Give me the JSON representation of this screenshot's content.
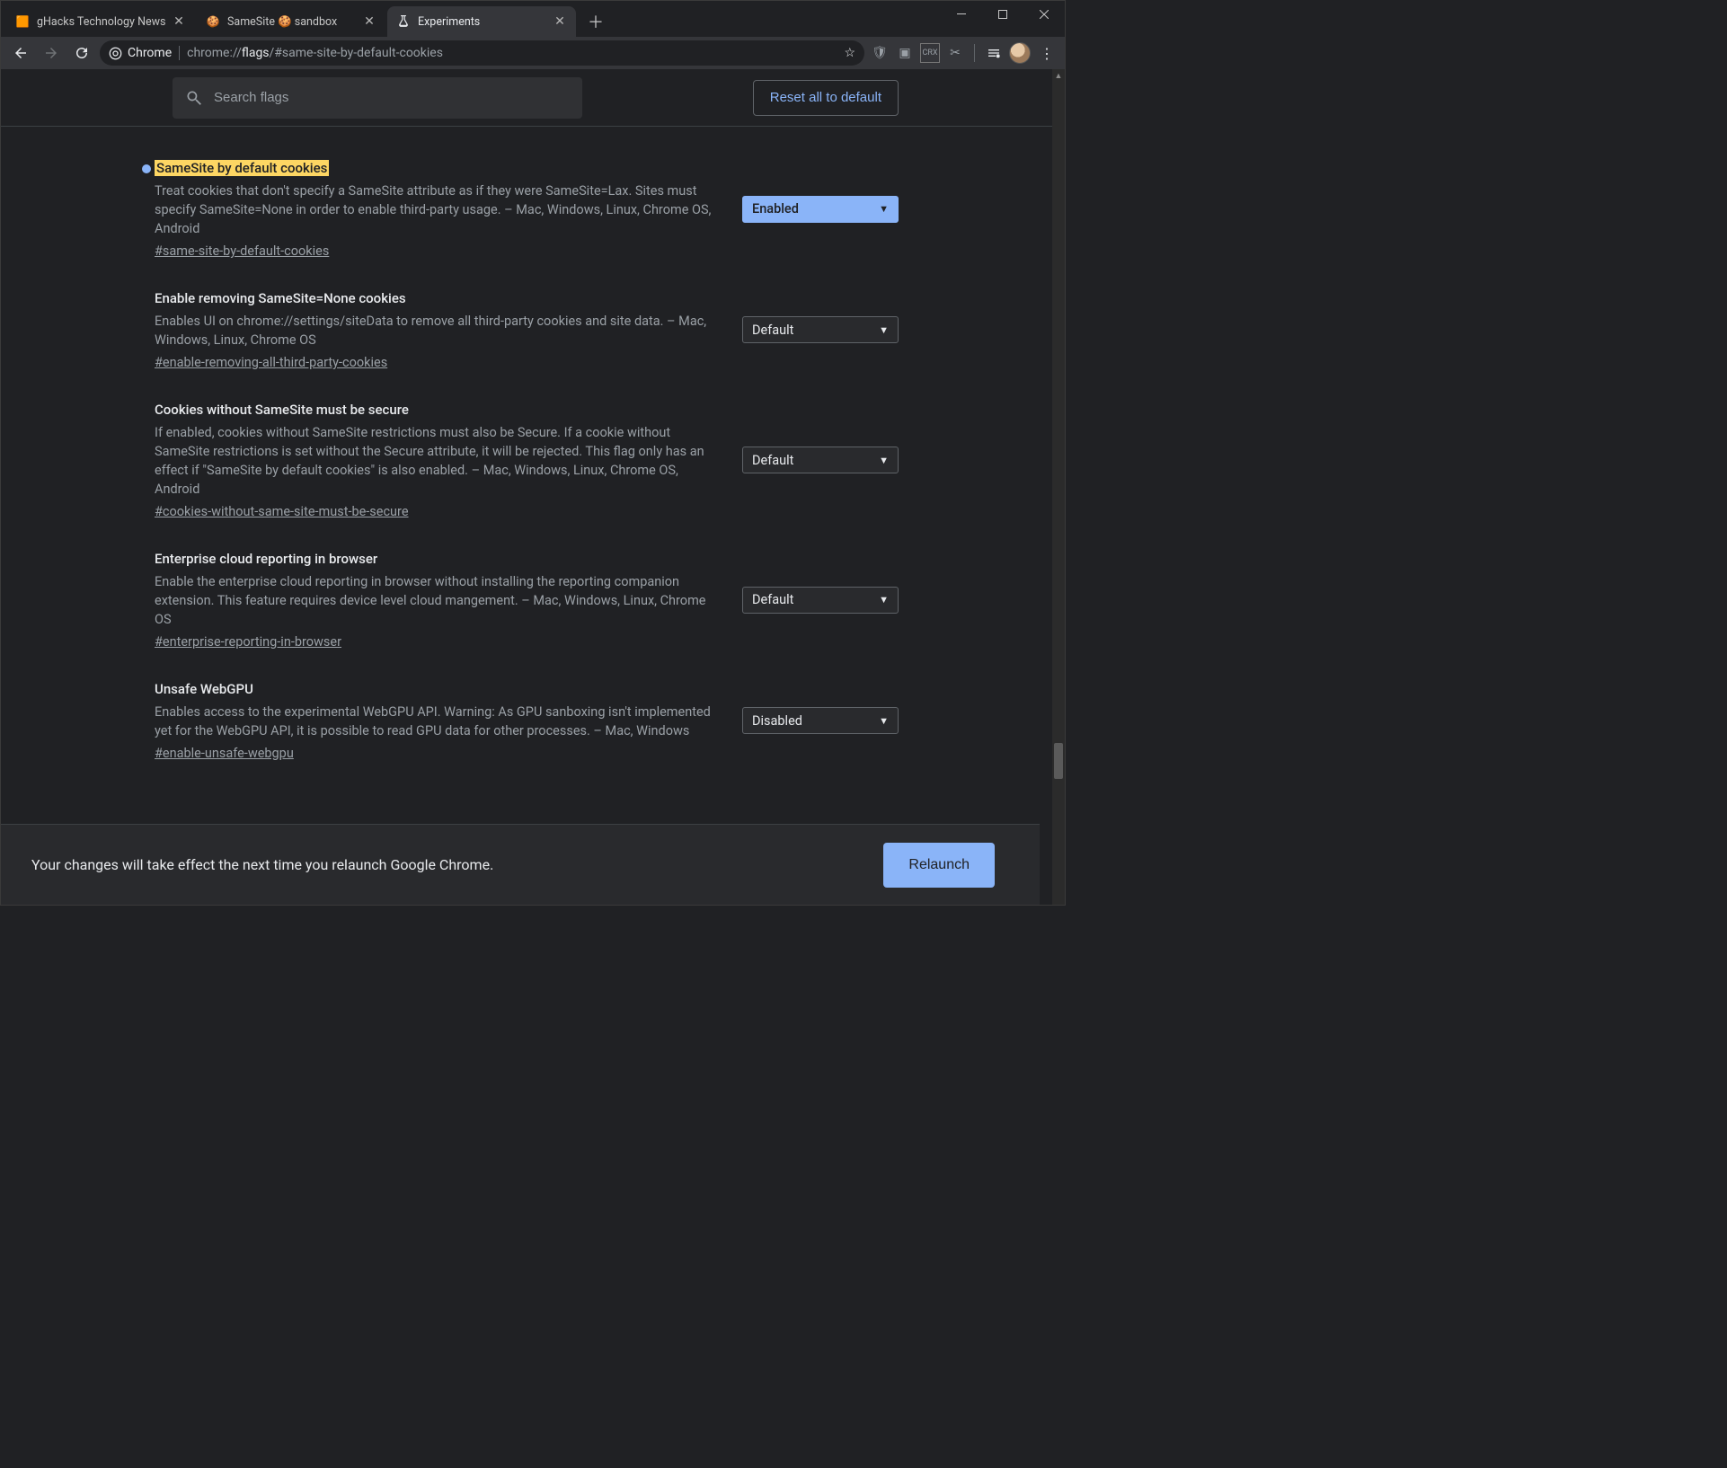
{
  "window": {
    "tabs": [
      {
        "title": "gHacks Technology News",
        "active": false
      },
      {
        "title": "SameSite 🍪 sandbox",
        "active": false
      },
      {
        "title": "Experiments",
        "active": true
      }
    ]
  },
  "toolbar": {
    "chip": "Chrome",
    "url_prefix": "chrome://",
    "url_bold": "flags",
    "url_suffix": "/#same-site-by-default-cookies"
  },
  "header": {
    "search_placeholder": "Search flags",
    "reset_label": "Reset all to default"
  },
  "flags": [
    {
      "highlight": true,
      "dot": true,
      "title": "SameSite by default cookies",
      "desc": "Treat cookies that don't specify a SameSite attribute as if they were SameSite=Lax. Sites must specify SameSite=None in order to enable third-party usage. – Mac, Windows, Linux, Chrome OS, Android",
      "anchor": "#same-site-by-default-cookies",
      "value": "Enabled",
      "value_state": "enabled"
    },
    {
      "title": "Enable removing SameSite=None cookies",
      "desc": "Enables UI on chrome://settings/siteData to remove all third-party cookies and site data. – Mac, Windows, Linux, Chrome OS",
      "anchor": "#enable-removing-all-third-party-cookies",
      "value": "Default",
      "value_state": "default"
    },
    {
      "title": "Cookies without SameSite must be secure",
      "desc": "If enabled, cookies without SameSite restrictions must also be Secure. If a cookie without SameSite restrictions is set without the Secure attribute, it will be rejected. This flag only has an effect if \"SameSite by default cookies\" is also enabled. – Mac, Windows, Linux, Chrome OS, Android",
      "anchor": "#cookies-without-same-site-must-be-secure",
      "value": "Default",
      "value_state": "default"
    },
    {
      "title": "Enterprise cloud reporting in browser",
      "desc": "Enable the enterprise cloud reporting in browser without installing the reporting companion extension. This feature requires device level cloud mangement. – Mac, Windows, Linux, Chrome OS",
      "anchor": "#enterprise-reporting-in-browser",
      "value": "Default",
      "value_state": "default"
    },
    {
      "title": "Unsafe WebGPU",
      "desc": "Enables access to the experimental WebGPU API. Warning: As GPU sanboxing isn't implemented yet for the WebGPU API, it is possible to read GPU data for other processes. – Mac, Windows",
      "anchor": "#enable-unsafe-webgpu",
      "value": "Disabled",
      "value_state": "default"
    }
  ],
  "footer": {
    "message": "Your changes will take effect the next time you relaunch Google Chrome.",
    "button": "Relaunch"
  }
}
